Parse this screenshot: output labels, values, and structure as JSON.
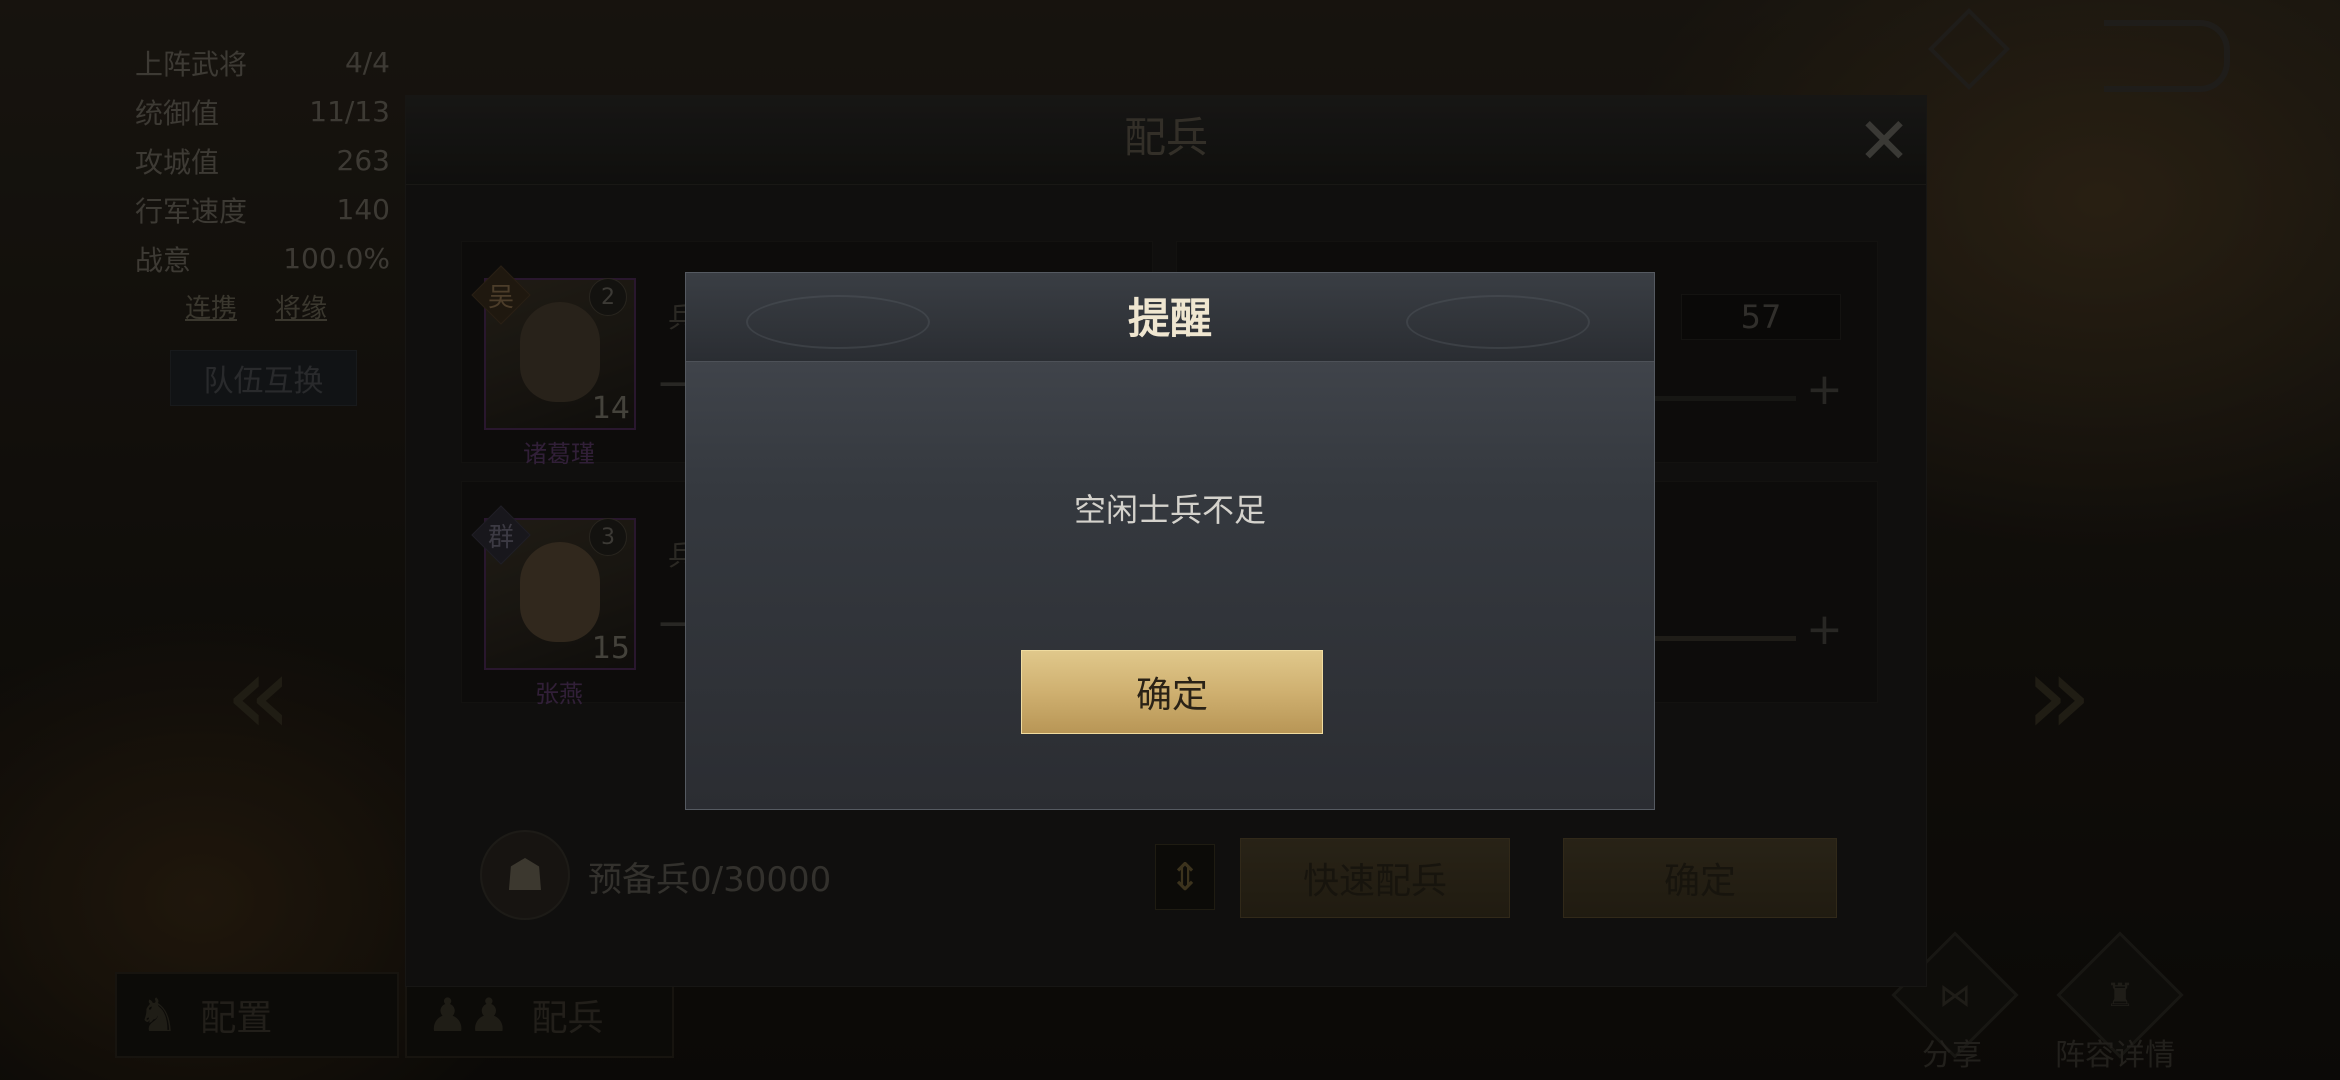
{
  "stats": [
    {
      "label": "上阵武将",
      "value": "4/4"
    },
    {
      "label": "统御值",
      "value": "11/13"
    },
    {
      "label": "攻城值",
      "value": "263"
    },
    {
      "label": "行军速度",
      "value": "140"
    },
    {
      "label": "战意",
      "value": "100.0%"
    }
  ],
  "links": {
    "combo": "连携",
    "bond": "将缘"
  },
  "swap_button": "队伍互换",
  "panel": {
    "title": "配兵",
    "generals": [
      {
        "faction": "吴",
        "stars": "2",
        "level": "14",
        "name": "诸葛瑾",
        "troop_label": "兵",
        "troops": "57"
      },
      {
        "faction": "群",
        "stars": "3",
        "level": "15",
        "name": "张燕",
        "troop_label": "兵"
      }
    ],
    "reserve": "预备兵0/30000",
    "quick_assign": "快速配兵",
    "confirm": "确定"
  },
  "bottom_tabs": {
    "config": "配置",
    "assign": "配兵"
  },
  "right_buttons": {
    "share": "分享",
    "lineup": "阵容详情"
  },
  "modal": {
    "title": "提醒",
    "message": "空闲士兵不足",
    "confirm": "确定"
  },
  "colors": {
    "accent_gold": "#cfb070",
    "rare_purple": "#4b2a54"
  }
}
